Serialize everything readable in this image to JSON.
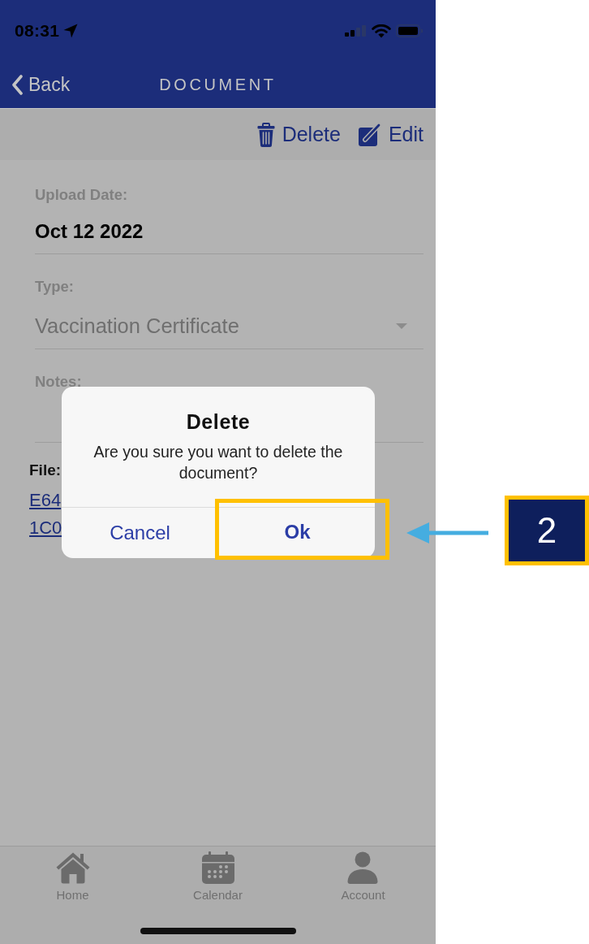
{
  "status_bar": {
    "time": "08:31"
  },
  "nav_bar": {
    "back_label": "Back",
    "title": "DOCUMENT"
  },
  "toolbar": {
    "actions": [
      {
        "kind": "delete",
        "label": "Delete"
      },
      {
        "kind": "edit",
        "label": "Edit"
      }
    ]
  },
  "form": {
    "fields": [
      {
        "kind": "text",
        "label": "Upload Date:",
        "value": "Oct 12 2022"
      },
      {
        "kind": "select",
        "label": "Type:",
        "value": "Vaccination Certificate"
      },
      {
        "kind": "textarea",
        "label": "Notes:"
      }
    ],
    "file": {
      "label": "File:",
      "links": [
        "E64",
        "1C0"
      ]
    }
  },
  "dialog": {
    "title": "Delete",
    "message": "Are you sure you want to delete the document?",
    "buttons": [
      {
        "kind": "cancel",
        "label": "Cancel",
        "highlighted": false
      },
      {
        "kind": "confirm",
        "label": "Ok",
        "highlighted": true
      }
    ]
  },
  "tab_bar": {
    "tabs": [
      {
        "kind": "home",
        "label": "Home"
      },
      {
        "kind": "calendar",
        "label": "Calendar"
      },
      {
        "kind": "account",
        "label": "Account"
      }
    ]
  },
  "callout": {
    "number": "2"
  }
}
